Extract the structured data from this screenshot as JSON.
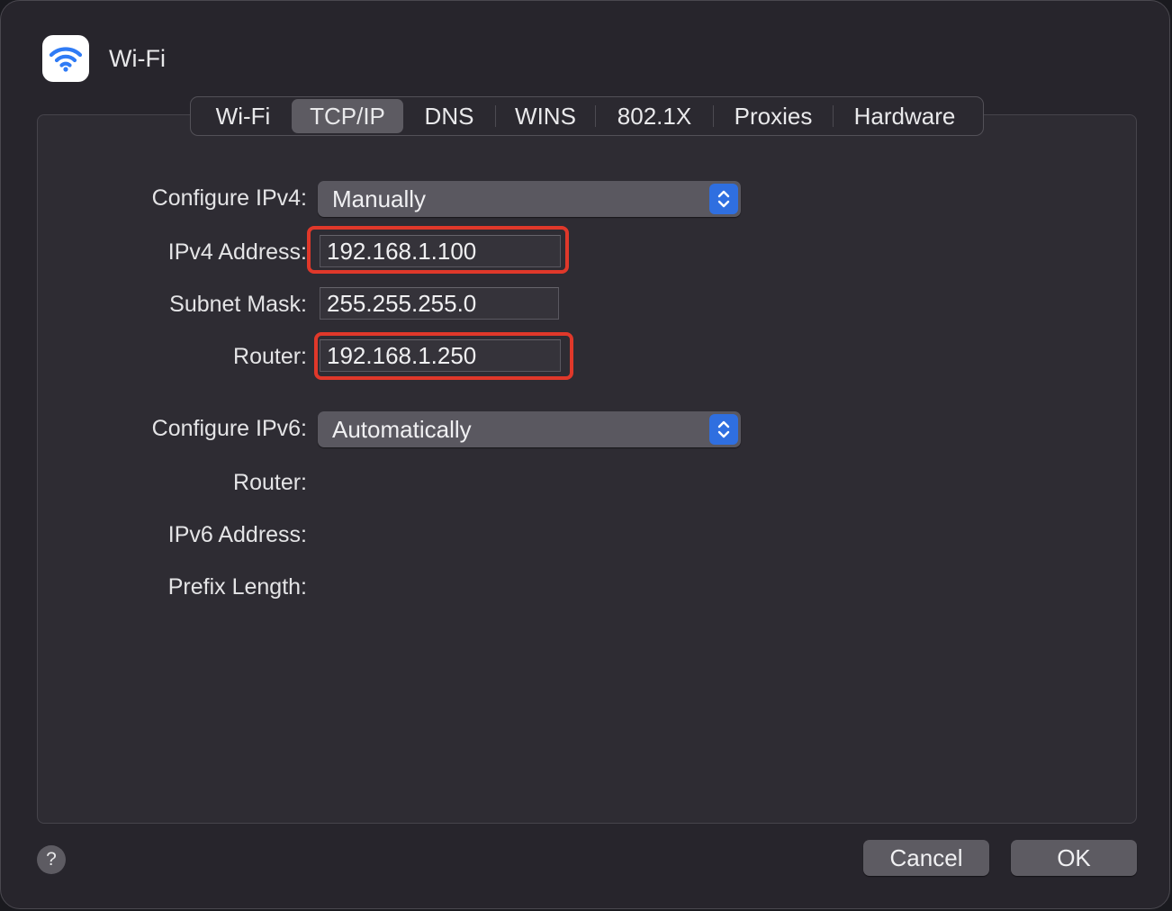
{
  "window": {
    "title": "Wi-Fi",
    "icon": "wifi-icon"
  },
  "tabs": [
    {
      "label": "Wi-Fi",
      "active": false
    },
    {
      "label": "TCP/IP",
      "active": true
    },
    {
      "label": "DNS",
      "active": false
    },
    {
      "label": "WINS",
      "active": false
    },
    {
      "label": "802.1X",
      "active": false
    },
    {
      "label": "Proxies",
      "active": false
    },
    {
      "label": "Hardware",
      "active": false
    }
  ],
  "ipv4": {
    "configure_label": "Configure IPv4:",
    "configure_value": "Manually",
    "address_label": "IPv4 Address:",
    "address_value": "192.168.1.100",
    "subnet_label": "Subnet Mask:",
    "subnet_value": "255.255.255.0",
    "router_label": "Router:",
    "router_value": "192.168.1.250"
  },
  "ipv6": {
    "configure_label": "Configure IPv6:",
    "configure_value": "Automatically",
    "router_label": "Router:",
    "address_label": "IPv6 Address:",
    "prefix_label": "Prefix Length:"
  },
  "footer": {
    "help_label": "?",
    "cancel_label": "Cancel",
    "ok_label": "OK"
  },
  "colors": {
    "accent": "#2f6fe0",
    "highlight": "#e0382a",
    "wifi": "#2f7bf5"
  }
}
